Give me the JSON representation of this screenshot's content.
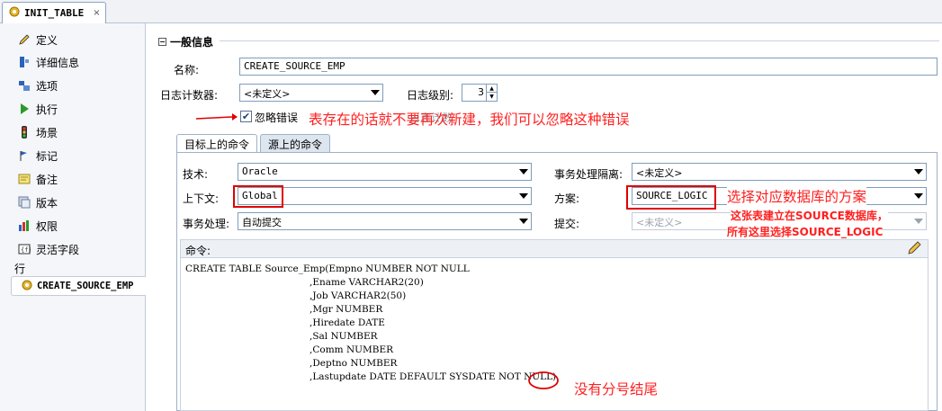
{
  "editor_tab": {
    "label": "INIT_TABLE",
    "close": "×"
  },
  "nav": {
    "items": [
      {
        "label": "定义",
        "icon": "pencil-icon"
      },
      {
        "label": "详细信息",
        "icon": "details-icon"
      },
      {
        "label": "选项",
        "icon": "options-icon"
      },
      {
        "label": "执行",
        "icon": "play-icon"
      },
      {
        "label": "场景",
        "icon": "traffic-light-icon"
      },
      {
        "label": "标记",
        "icon": "markers-icon"
      },
      {
        "label": "备注",
        "icon": "memo-icon"
      },
      {
        "label": "版本",
        "icon": "version-icon"
      },
      {
        "label": "权限",
        "icon": "privileges-icon"
      },
      {
        "label": "灵活字段",
        "icon": "flexfield-icon"
      }
    ],
    "group_label": "行",
    "selected_row": "CREATE_SOURCE_EMP"
  },
  "general": {
    "section_title": "一般信息",
    "name_label": "名称:",
    "name_value": "CREATE_SOURCE_EMP",
    "log_counter_label": "日志计数器:",
    "log_counter_value": "<未定义>",
    "log_level_label": "日志级别:",
    "log_level_value": "3",
    "ignore_errors_label": "忽略错误",
    "ignore_errors_checked": true
  },
  "tabs": {
    "target": "目标上的命令",
    "source": "源上的命令"
  },
  "target": {
    "technology_label": "技术:",
    "technology_value": "Oracle",
    "context_label": "上下文:",
    "context_value": "Global",
    "transaction_label": "事务处理:",
    "transaction_value": "自动提交",
    "isolation_label": "事务处理隔离:",
    "isolation_value": "<未定义>",
    "schema_label": "方案:",
    "schema_value": "SOURCE_LOGIC",
    "commit_label": "提交:",
    "commit_value": "<未定义>",
    "command_label": "命令:",
    "command_lines": [
      "CREATE TABLE Source_Emp(Empno NUMBER NOT NULL",
      ",Ename VARCHAR2(20)",
      ",Job VARCHAR2(50)",
      ",Mgr NUMBER",
      ",Hiredate DATE",
      ",Sal NUMBER",
      ",Comm NUMBER",
      ",Deptno NUMBER",
      ",Lastupdate DATE DEFAULT SYSDATE NOT NULL)"
    ]
  },
  "annotations": {
    "ignore_note": "表存在的话就不要再次新建，我们可以忽略这种错误",
    "hidden_overlap": "日志计数",
    "schema_note": "选择对应数据库的方案",
    "schema_detail_1": "这张表建立在SOURCE数据库，",
    "schema_detail_2": "所有这里选择SOURCE_LOGIC",
    "semicolon_note": "没有分号结尾"
  },
  "colors": {
    "annotation": "#ff2020",
    "highlight_box": "#e00000"
  }
}
